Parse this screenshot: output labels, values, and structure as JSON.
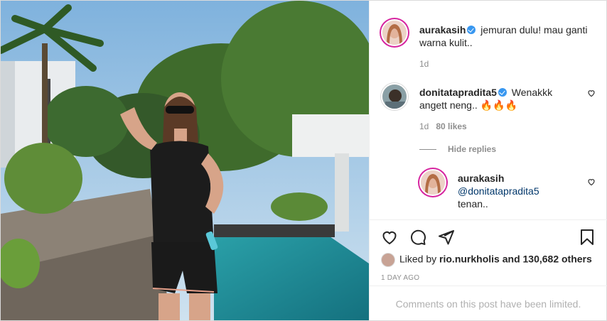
{
  "post": {
    "caption": {
      "username": "aurakasih",
      "text": "jemuran dulu! mau ganti warna kulit..",
      "time": "1d"
    },
    "comment": {
      "username": "donitatapradita5",
      "text": "Wenakkk angett neng.. 🔥🔥🔥",
      "time": "1d",
      "likes": "80 likes"
    },
    "hide_replies_label": "Hide replies",
    "reply": {
      "username": "aurakasih",
      "mention": "@donitatapradita5",
      "text": "tenan.."
    },
    "liked_by_prefix": "Liked by",
    "liked_by_user": "rio.nurkholis",
    "liked_by_suffix": "and 130,682 others",
    "timestamp": "1 DAY AGO",
    "comments_limited": "Comments on this post have been limited."
  },
  "colors": {
    "verified": "#3897f0",
    "link": "#00376b",
    "muted": "#8e8e8e",
    "pool": "#1f8a9a"
  },
  "icons": [
    "verified-badge-icon",
    "heart-icon",
    "comment-icon",
    "share-icon",
    "bookmark-icon"
  ]
}
